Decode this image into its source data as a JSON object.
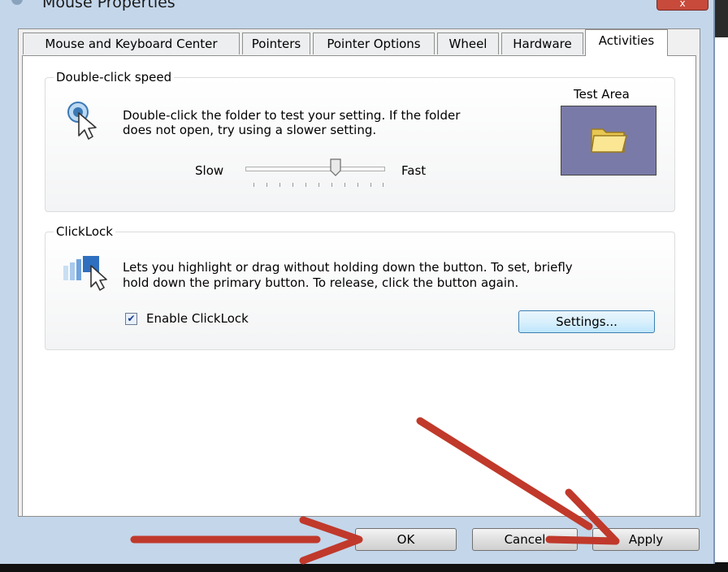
{
  "window": {
    "title": "Mouse Properties",
    "close_glyph": "x"
  },
  "tabs": [
    {
      "label": "Mouse and Keyboard Center"
    },
    {
      "label": "Pointers"
    },
    {
      "label": "Pointer Options"
    },
    {
      "label": "Wheel"
    },
    {
      "label": "Hardware"
    },
    {
      "label": "Activities",
      "active": true
    }
  ],
  "double_click": {
    "group_label": "Double-click speed",
    "description_line1": "Double-click the folder to test your setting. If the folder",
    "description_line2": "does not open, try using a slower setting.",
    "test_area_label": "Test Area",
    "slider": {
      "min_label": "Slow",
      "max_label": "Fast",
      "level": 0.65
    },
    "icon": "mouse-pointer-click-icon",
    "test_icon": "folder-icon"
  },
  "clicklock": {
    "group_label": "ClickLock",
    "description_line1": "Lets you highlight or drag without holding down the button. To set, briefly",
    "description_line2": "hold down the primary button. To release, click the button again.",
    "checkbox_label": "Enable ClickLock",
    "checked": true,
    "settings_label": "Settings...",
    "icon": "drag-pointer-icon"
  },
  "footer": {
    "ok_label": "OK",
    "cancel_label": "Cancel",
    "apply_label": "Apply"
  },
  "colors": {
    "accent": "#3c7fb1",
    "annotation_arrow": "#c0392b",
    "test_area": "#7a7aa8"
  }
}
